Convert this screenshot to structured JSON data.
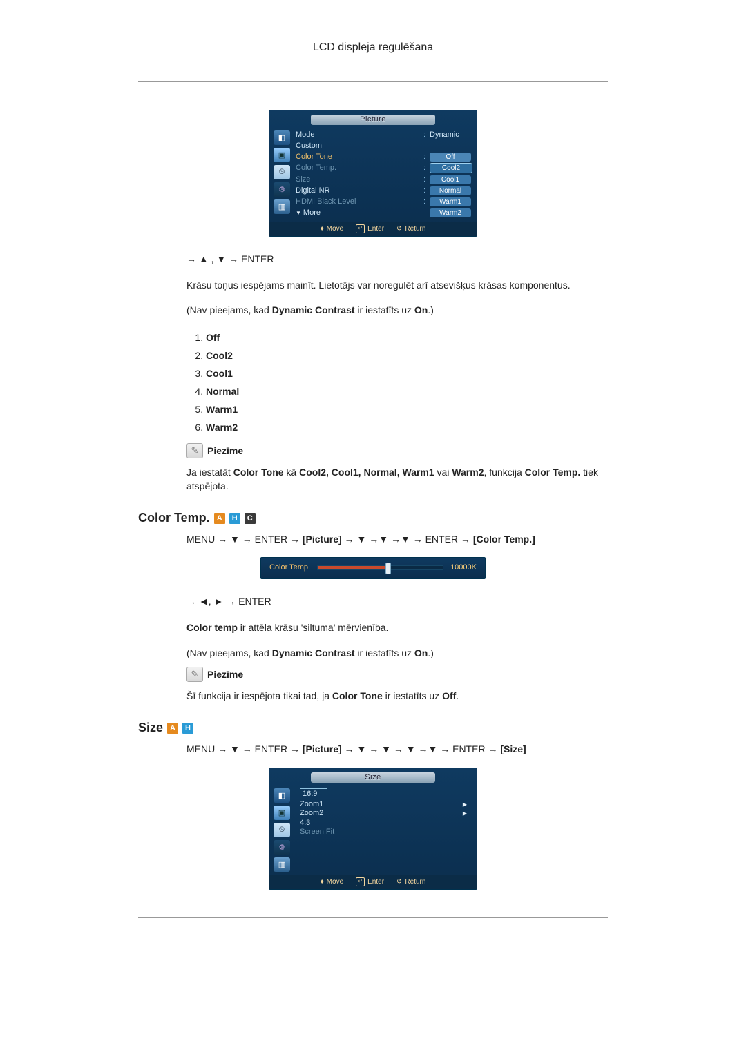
{
  "header": {
    "title": "LCD displeja regulēšana"
  },
  "osd1": {
    "title": "Picture",
    "rows": {
      "mode": {
        "label": "Mode",
        "sep": ":",
        "value": "Dynamic"
      },
      "custom": {
        "label": "Custom"
      },
      "colorTone": {
        "label": "Color Tone",
        "sep": ":",
        "value": "Off"
      },
      "colorTemp": {
        "label": "Color Temp.",
        "sep": ":",
        "value": "Cool2"
      },
      "size": {
        "label": "Size",
        "sep": ":",
        "value": "Cool1"
      },
      "digitalNR": {
        "label": "Digital NR",
        "sep": ":",
        "value": "Normal"
      },
      "hdmiBL": {
        "label": "HDMI Black Level",
        "sep": ":",
        "value": "Warm1"
      },
      "more": {
        "label": "More",
        "value": "Warm2"
      }
    },
    "footer": {
      "move": "Move",
      "enter": "Enter",
      "return": "Return"
    }
  },
  "nav1": "→ ▲ , ▼ → ENTER",
  "para1": "Krāsu toņus iespējams mainīt. Lietotājs var noregulēt arī atsevišķus krāsas komponentus.",
  "para2_pre": "(Nav pieejams, kad ",
  "para2_b1": "Dynamic Contrast",
  "para2_mid": " ir iestatīts uz ",
  "para2_b2": "On",
  "para2_post": ".)",
  "options": [
    "Off",
    "Cool2",
    "Cool1",
    "Normal",
    "Warm1",
    "Warm2"
  ],
  "note_label": "Piezīme",
  "note1_pre": "Ja iestatāt ",
  "note1_b1": "Color Tone",
  "note1_mid1": " kā ",
  "note1_list": "Cool2, Cool1, Normal, Warm1",
  "note1_or": " vai ",
  "note1_b2": "Warm2",
  "note1_mid2": ", funkcija ",
  "note1_b3": "Color Temp.",
  "note1_post": " tiek atspējota.",
  "sec_colortemp": {
    "title": "Color Temp."
  },
  "menuPathCT_pre": "MENU → ▼ → ENTER → ",
  "menuPathCT_b1": "[Picture]",
  "menuPathCT_mid": " → ▼ →▼ →▼ → ENTER → ",
  "menuPathCT_b2": "[Color Temp.]",
  "osdSlider": {
    "label": "Color Temp.",
    "value": "10000K"
  },
  "nav2": "→ ◄, ► → ENTER",
  "ct_para_b": "Color temp",
  "ct_para_post": " ir attēla krāsu 'siltuma' mērvienība.",
  "ct_note_pre": "Šī funkcija ir iespējota tikai tad, ja ",
  "ct_note_b1": "Color Tone",
  "ct_note_mid": " ir iestatīts uz ",
  "ct_note_b2": "Off",
  "ct_note_post": ".",
  "sec_size": {
    "title": "Size"
  },
  "menuPathSZ_pre": "MENU → ▼ → ENTER → ",
  "menuPathSZ_b1": "[Picture]",
  "menuPathSZ_mid": " → ▼ → ▼ → ▼ →▼ → ENTER → ",
  "menuPathSZ_b2": "[Size]",
  "osdSize": {
    "title": "Size",
    "items": {
      "r1": "16:9",
      "r2": "Zoom1",
      "r3": "Zoom2",
      "r4": "4:3",
      "r5": "Screen Fit"
    },
    "footer": {
      "move": "Move",
      "enter": "Enter",
      "return": "Return"
    }
  },
  "badges": {
    "A": "A",
    "H": "H",
    "C": "C"
  }
}
